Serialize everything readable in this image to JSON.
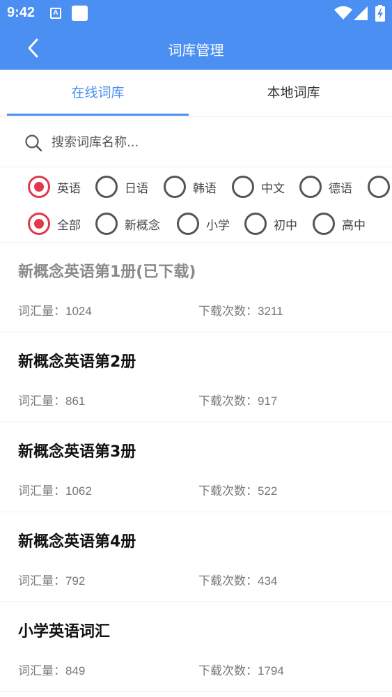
{
  "status_bar": {
    "time": "9:42",
    "notif_a": "A"
  },
  "appbar": {
    "title": "词库管理"
  },
  "tabs": [
    {
      "label": "在线词库",
      "active": true
    },
    {
      "label": "本地词库",
      "active": false
    }
  ],
  "search": {
    "placeholder": "搜索词库名称..."
  },
  "language_filter": [
    {
      "label": "英语",
      "checked": true
    },
    {
      "label": "日语",
      "checked": false
    },
    {
      "label": "韩语",
      "checked": false
    },
    {
      "label": "中文",
      "checked": false
    },
    {
      "label": "德语",
      "checked": false
    },
    {
      "label": "",
      "checked": false
    }
  ],
  "level_filter": [
    {
      "label": "全部",
      "checked": true
    },
    {
      "label": "新概念",
      "checked": false
    },
    {
      "label": "小学",
      "checked": false
    },
    {
      "label": "初中",
      "checked": false
    },
    {
      "label": "高中",
      "checked": false
    }
  ],
  "labels": {
    "word_count": "词汇量：",
    "download_count": "下载次数："
  },
  "items": [
    {
      "title": "新概念英语第1册(已下载)",
      "word_count": "1024",
      "download_count": "3211",
      "downloaded": true
    },
    {
      "title": "新概念英语第2册",
      "word_count": "861",
      "download_count": "917",
      "downloaded": false
    },
    {
      "title": "新概念英语第3册",
      "word_count": "1062",
      "download_count": "522",
      "downloaded": false
    },
    {
      "title": "新概念英语第4册",
      "word_count": "792",
      "download_count": "434",
      "downloaded": false
    },
    {
      "title": "小学英语词汇",
      "word_count": "849",
      "download_count": "1794",
      "downloaded": false
    }
  ],
  "colors": {
    "primary": "#4a8ff1",
    "radio_checked": "#e2384d"
  }
}
